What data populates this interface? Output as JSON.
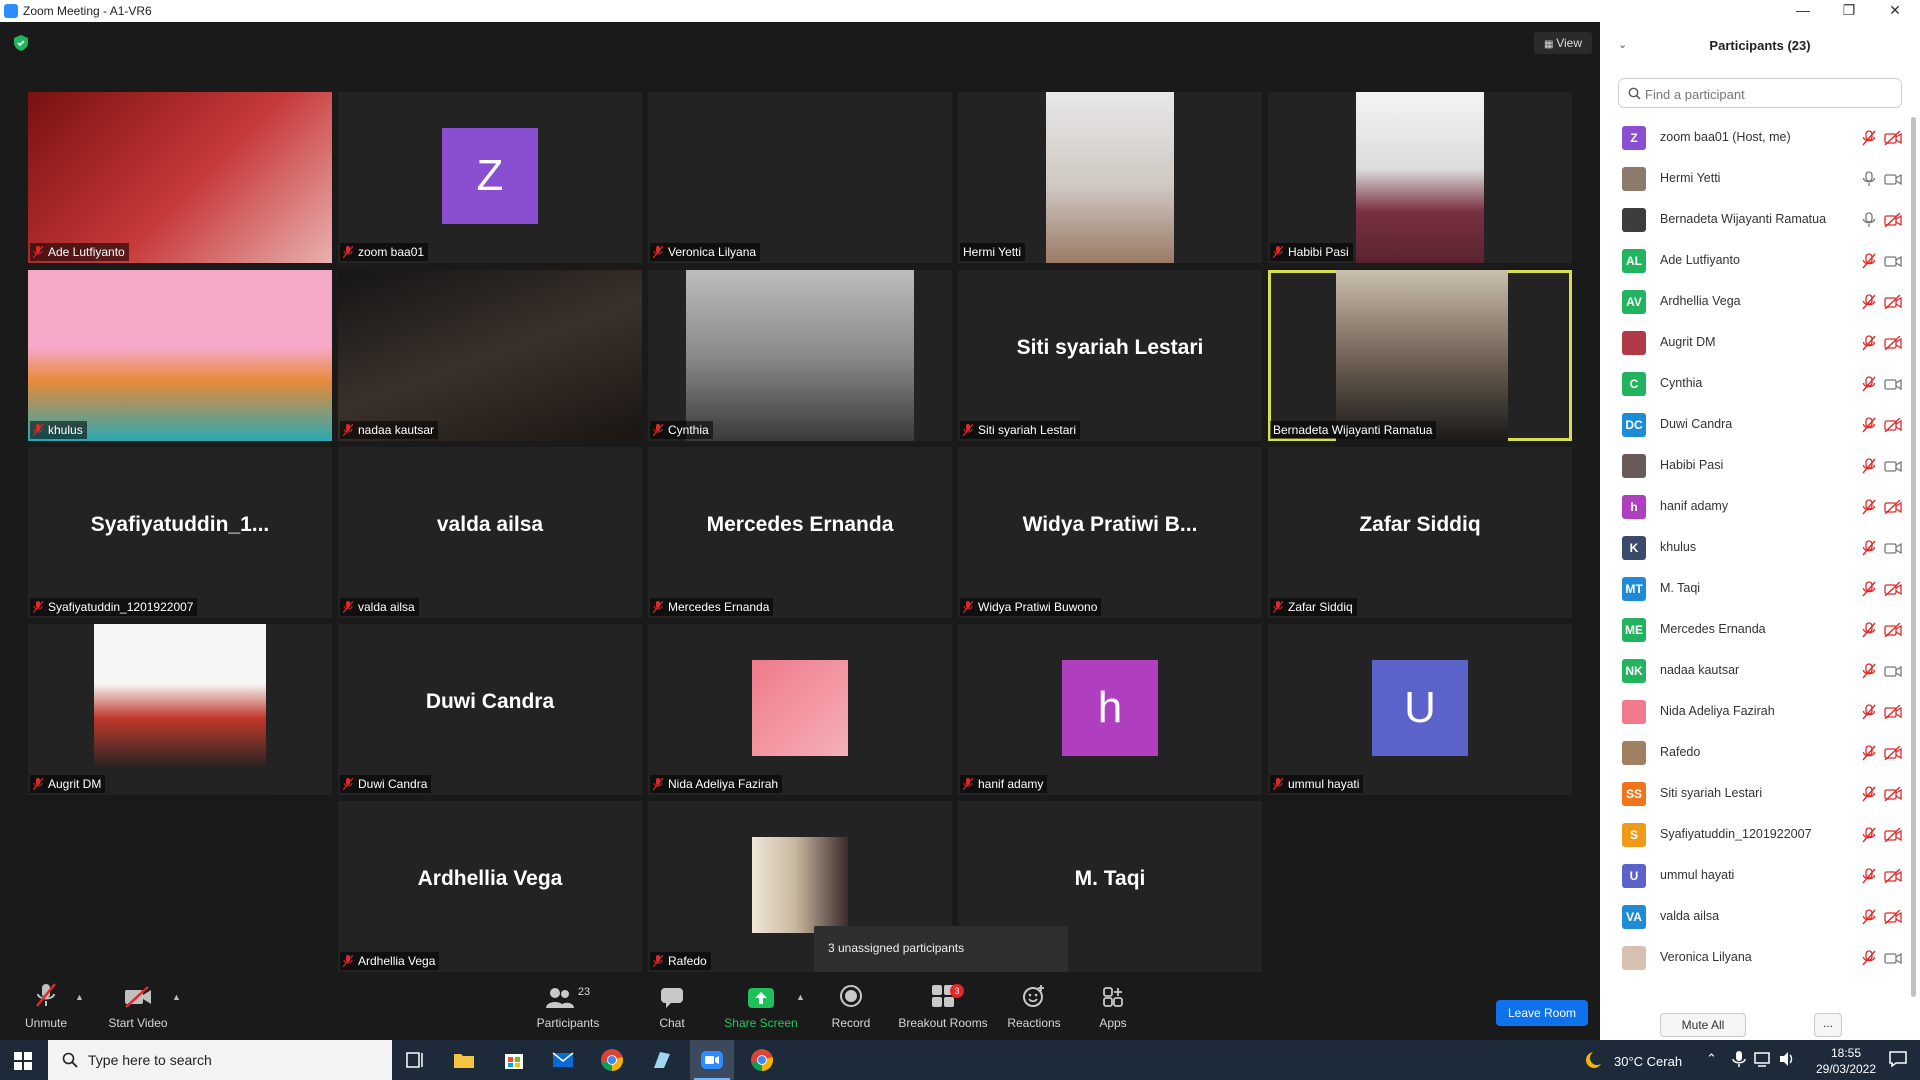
{
  "window": {
    "title": "Zoom Meeting - A1-VR6",
    "minimize": "—",
    "maximize": "❐",
    "close": "✕"
  },
  "view_label": "View",
  "tiles": [
    {
      "label": "Ade Lutfiyanto",
      "muted": true
    },
    {
      "label": "zoom baa01",
      "muted": true,
      "avatar": "Z",
      "avatar_color": "#8a4fd1"
    },
    {
      "label": "Veronica Lilyana",
      "muted": true
    },
    {
      "label": "Hermi Yetti",
      "muted": false
    },
    {
      "label": "Habibi Pasi",
      "muted": true
    },
    {
      "label": "khulus",
      "muted": true
    },
    {
      "label": "nadaa kautsar",
      "muted": true
    },
    {
      "label": "Cynthia",
      "muted": true
    },
    {
      "label": "Siti syariah Lestari",
      "muted": true,
      "big": "Siti syariah Lestari"
    },
    {
      "label": "Bernadeta Wijayanti Ramatua",
      "muted": false,
      "active": true
    },
    {
      "label": "Syafiyatuddin_1201922007",
      "muted": true,
      "big": "Syafiyatuddin_1..."
    },
    {
      "label": "valda ailsa",
      "muted": true,
      "big": "valda ailsa"
    },
    {
      "label": "Mercedes Ernanda",
      "muted": true,
      "big": "Mercedes Ernanda"
    },
    {
      "label": "Widya Pratiwi Buwono",
      "muted": true,
      "big": "Widya Pratiwi B..."
    },
    {
      "label": "Zafar Siddiq",
      "muted": true,
      "big": "Zafar Siddiq"
    },
    {
      "label": "Augrit DM",
      "muted": true
    },
    {
      "label": "Duwi Candra",
      "muted": true,
      "big": "Duwi Candra"
    },
    {
      "label": "Nida Adeliya Fazirah",
      "muted": true
    },
    {
      "label": "hanif adamy",
      "muted": true,
      "avatar": "h",
      "avatar_color": "#b03fbf"
    },
    {
      "label": "ummul hayati",
      "muted": true,
      "avatar": "U",
      "avatar_color": "#5b62c9"
    },
    {
      "label": "Ardhellia Vega",
      "muted": true,
      "big": "Ardhellia Vega"
    },
    {
      "label": "Rafedo",
      "muted": true
    },
    {
      "label": "",
      "muted": false,
      "big": "M. Taqi"
    }
  ],
  "tooltip": "3 unassigned participants",
  "toolbar": {
    "unmute": "Unmute",
    "start_video": "Start Video",
    "participants": "Participants",
    "participants_count": "23",
    "chat": "Chat",
    "share_screen": "Share Screen",
    "record": "Record",
    "breakout_rooms": "Breakout Rooms",
    "breakout_badge": "3",
    "reactions": "Reactions",
    "apps": "Apps",
    "leave_room": "Leave Room"
  },
  "panel": {
    "title": "Participants (23)",
    "search_placeholder": "Find a participant",
    "mute_all": "Mute All",
    "more": "...",
    "participants": [
      {
        "name": "zoom baa01 (Host, me)",
        "initials": "Z",
        "color": "#8a4fd1",
        "mic": "muted",
        "cam": "off"
      },
      {
        "name": "Hermi Yetti",
        "initials": "",
        "color": "#8c7a6a",
        "mic": "on",
        "cam": "on"
      },
      {
        "name": "Bernadeta Wijayanti Ramatua",
        "initials": "",
        "color": "#3d3d3d",
        "mic": "on",
        "cam": "off"
      },
      {
        "name": "Ade Lutfiyanto",
        "initials": "AL",
        "color": "#22b35e",
        "mic": "muted",
        "cam": "on"
      },
      {
        "name": "Ardhellia Vega",
        "initials": "AV",
        "color": "#22b35e",
        "mic": "muted",
        "cam": "off"
      },
      {
        "name": "Augrit DM",
        "initials": "",
        "color": "#b23a48",
        "mic": "muted",
        "cam": "off"
      },
      {
        "name": "Cynthia",
        "initials": "C",
        "color": "#22b35e",
        "mic": "muted",
        "cam": "on"
      },
      {
        "name": "Duwi Candra",
        "initials": "DC",
        "color": "#1f8ad6",
        "mic": "muted",
        "cam": "off"
      },
      {
        "name": "Habibi Pasi",
        "initials": "",
        "color": "#6a5a5a",
        "mic": "muted",
        "cam": "on"
      },
      {
        "name": "hanif adamy",
        "initials": "h",
        "color": "#b03fbf",
        "mic": "muted",
        "cam": "off"
      },
      {
        "name": "khulus",
        "initials": "K",
        "color": "#3b4a6a",
        "mic": "muted",
        "cam": "on"
      },
      {
        "name": "M. Taqi",
        "initials": "MT",
        "color": "#1f8ad6",
        "mic": "muted",
        "cam": "off"
      },
      {
        "name": "Mercedes Ernanda",
        "initials": "ME",
        "color": "#22b35e",
        "mic": "muted",
        "cam": "off"
      },
      {
        "name": "nadaa kautsar",
        "initials": "NK",
        "color": "#22b35e",
        "mic": "muted",
        "cam": "on"
      },
      {
        "name": "Nida Adeliya Fazirah",
        "initials": "",
        "color": "#f07a8a",
        "mic": "muted",
        "cam": "off"
      },
      {
        "name": "Rafedo",
        "initials": "",
        "color": "#a08060",
        "mic": "muted",
        "cam": "off"
      },
      {
        "name": "Siti syariah Lestari",
        "initials": "SS",
        "color": "#f0741a",
        "mic": "muted",
        "cam": "off"
      },
      {
        "name": "Syafiyatuddin_1201922007",
        "initials": "S",
        "color": "#f09a1a",
        "mic": "muted",
        "cam": "off"
      },
      {
        "name": "ummul hayati",
        "initials": "U",
        "color": "#5b62c9",
        "mic": "muted",
        "cam": "off"
      },
      {
        "name": "valda ailsa",
        "initials": "VA",
        "color": "#1f8ad6",
        "mic": "muted",
        "cam": "off"
      },
      {
        "name": "Veronica Lilyana",
        "initials": "",
        "color": "#d8c0b0",
        "mic": "muted",
        "cam": "on"
      }
    ]
  },
  "taskbar": {
    "search_placeholder": "Type here to search",
    "weather": "30°C  Cerah",
    "time": "18:55",
    "date": "29/03/2022"
  }
}
